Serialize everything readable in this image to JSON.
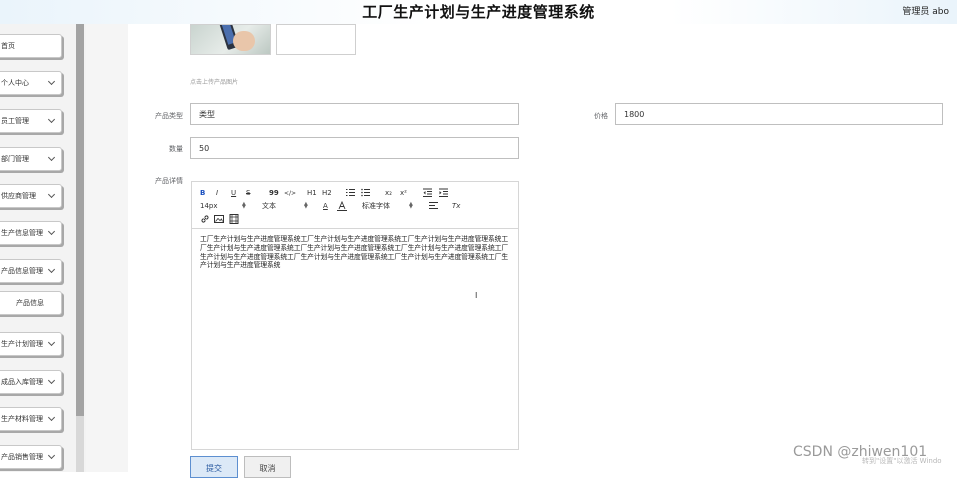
{
  "header": {
    "title": "工厂生产计划与生产进度管理系统",
    "user": "管理员 abo"
  },
  "sidebar": {
    "items": [
      {
        "label": "首页"
      },
      {
        "label": "个人中心"
      },
      {
        "label": "员工管理"
      },
      {
        "label": "部门管理"
      },
      {
        "label": "供应商管理"
      },
      {
        "label": "生产信息管理"
      },
      {
        "label": "产品信息管理"
      },
      {
        "label": "产品信息"
      },
      {
        "label": "生产计划管理"
      },
      {
        "label": "成品入库管理"
      },
      {
        "label": "生产材料管理"
      },
      {
        "label": "产品销售管理"
      }
    ]
  },
  "form": {
    "upload_hint": "点击上传产品图片",
    "product_type_label": "产品类型",
    "product_type_value": "类型",
    "price_label": "价格",
    "price_value": "1800",
    "quantity_label": "数量",
    "quantity_value": "50",
    "details_label": "产品详情",
    "details_text": "工厂生产计划与生产进度管理系统工厂生产计划与生产进度管理系统工厂生产计划与生产进度管理系统工厂生产计划与生产进度管理系统工厂生产计划与生产进度管理系统工厂生产计划与生产进度管理系统工厂生产计划与生产进度管理系统工厂生产计划与生产进度管理系统工厂生产计划与生产进度管理系统工厂生产计划与生产进度管理系统",
    "submit_label": "提交",
    "cancel_label": "取消"
  },
  "editor": {
    "bold": "B",
    "italic": "I",
    "underline": "U",
    "strike": "S",
    "quote": "99",
    "code": "</>",
    "h1": "H1",
    "h2": "H2",
    "sub": "x₂",
    "sup": "x²",
    "size_value": "14px",
    "text_style_value": "文本",
    "font_color": "A",
    "font_family_value": "标准字体",
    "clear_format": "Tx"
  },
  "watermark": {
    "text": "CSDN @zhiwen101",
    "faint_text": "转到\"设置\"以激活 Windo"
  },
  "colors": {
    "accent": "#1a4fbf",
    "submit_bg": "#dce9f7",
    "border": "#bfbfbf"
  }
}
